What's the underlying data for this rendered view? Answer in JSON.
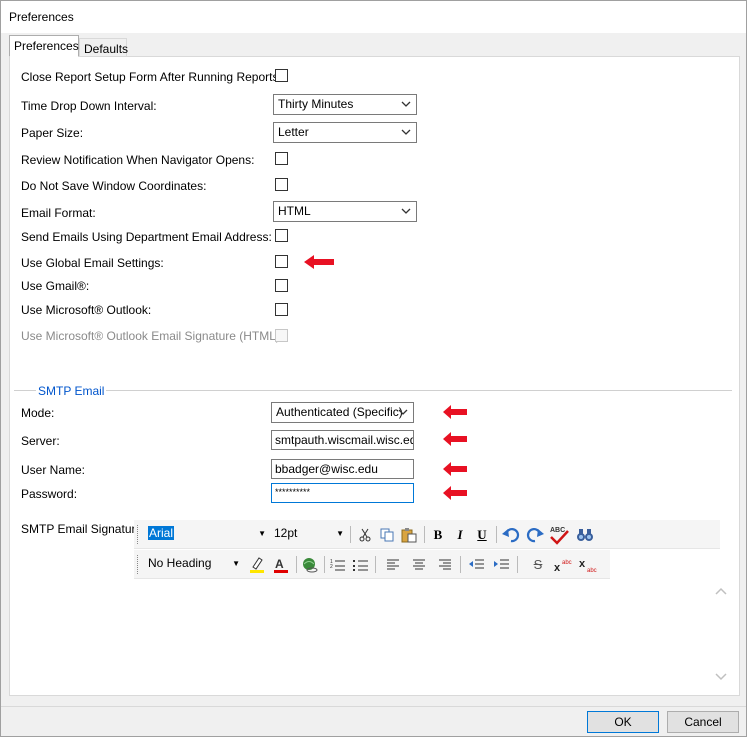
{
  "window": {
    "title": "Preferences"
  },
  "tabs": [
    {
      "label": "Preferences",
      "active": true
    },
    {
      "label": "Defaults",
      "active": false
    }
  ],
  "preferences": {
    "close_report_label": "Close Report Setup Form After Running Reports:",
    "close_report_checked": false,
    "time_interval_label": "Time Drop Down Interval:",
    "time_interval_value": "Thirty Minutes",
    "paper_size_label": "Paper Size:",
    "paper_size_value": "Letter",
    "review_notification_label": "Review Notification When Navigator Opens:",
    "review_notification_checked": false,
    "do_not_save_coords_label": "Do Not Save Window Coordinates:",
    "do_not_save_coords_checked": false,
    "email_format_label": "Email Format:",
    "email_format_value": "HTML",
    "send_dept_email_label": "Send Emails Using Department Email Address:",
    "send_dept_email_checked": false,
    "use_global_email_label": "Use Global Email Settings:",
    "use_global_email_checked": false,
    "use_gmail_label": "Use Gmail®:",
    "use_gmail_checked": false,
    "use_outlook_label": "Use Microsoft® Outlook:",
    "use_outlook_checked": false,
    "use_outlook_sig_label": "Use Microsoft® Outlook Email Signature (HTML):",
    "use_outlook_sig_checked": false
  },
  "smtp": {
    "group_title": "SMTP Email",
    "mode_label": "Mode:",
    "mode_value": "Authenticated (Specific)",
    "server_label": "Server:",
    "server_value": "smtpauth.wiscmail.wisc.edu",
    "username_label": "User Name:",
    "username_value": "bbadger@wisc.edu",
    "password_label": "Password:",
    "password_value": "**********",
    "signature_label": "SMTP Email Signature:"
  },
  "editor": {
    "font_name": "Arial",
    "font_size": "12pt",
    "heading": "No Heading",
    "icons": [
      "cut-icon",
      "copy-icon",
      "paste-icon",
      "bold-icon",
      "italic-icon",
      "underline-icon",
      "undo-icon",
      "redo-icon",
      "spellcheck-icon",
      "find-icon",
      "highlight-icon",
      "font-color-icon",
      "hyperlink-icon",
      "numbered-list-icon",
      "bulleted-list-icon",
      "align-left-icon",
      "align-center-icon",
      "align-right-icon",
      "outdent-icon",
      "indent-icon",
      "strikethrough-icon",
      "superscript-icon",
      "subscript-icon"
    ]
  },
  "buttons": {
    "ok": "OK",
    "cancel": "Cancel"
  },
  "colors": {
    "accent": "#0078d7",
    "annotation_arrow": "#e81123",
    "group_title": "#0055cc"
  }
}
